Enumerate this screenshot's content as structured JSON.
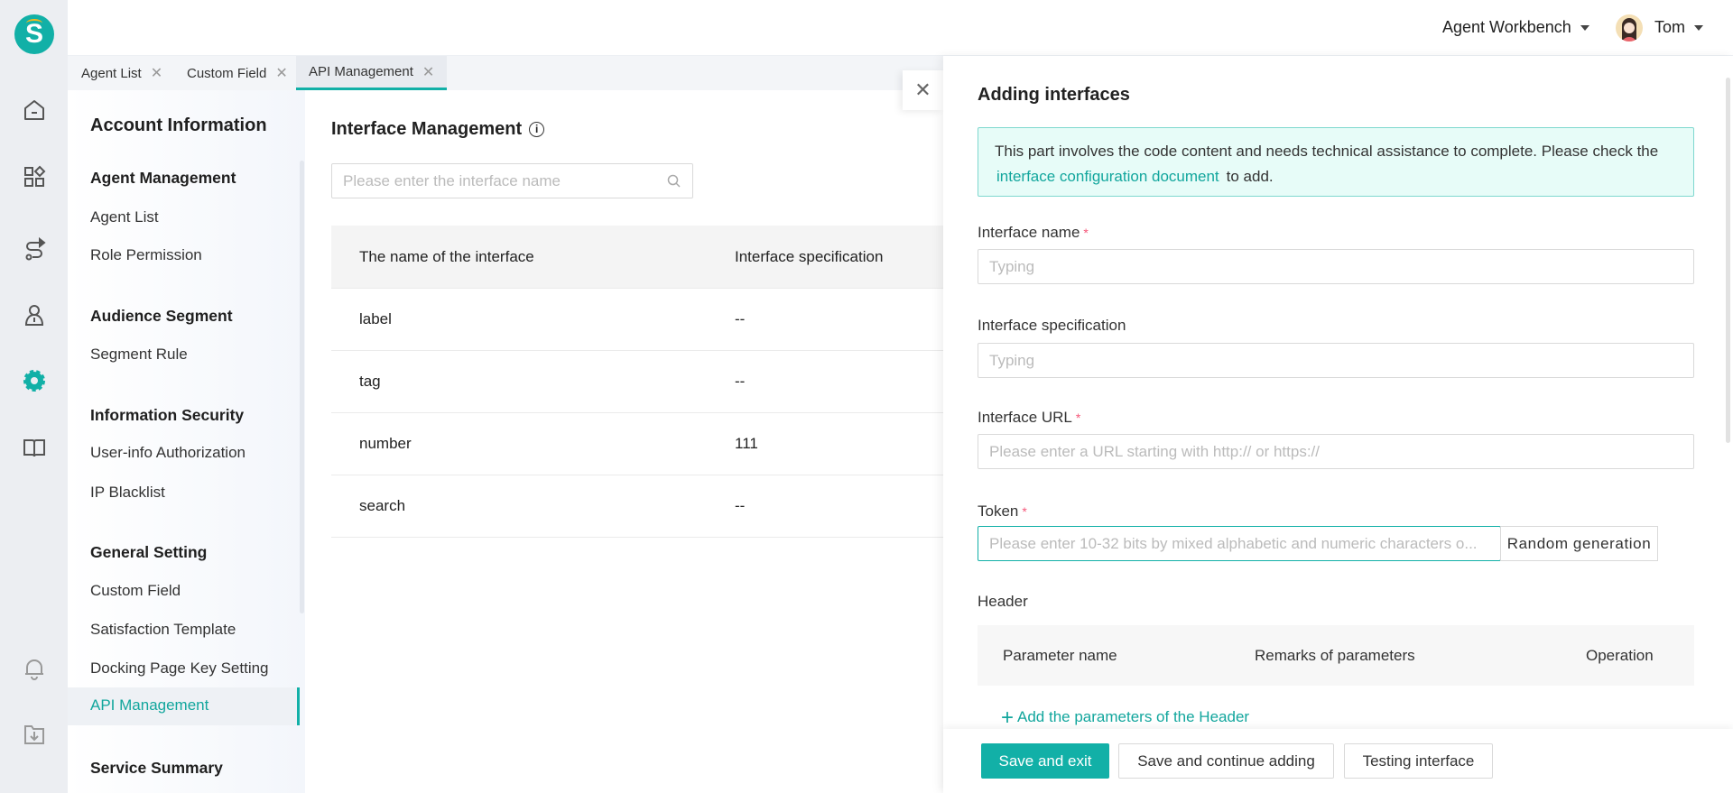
{
  "header": {
    "workspace": "Agent Workbench",
    "user": "Tom"
  },
  "iconbar": {
    "items": [
      "home-icon",
      "apps-icon",
      "routing-icon",
      "agent-icon",
      "settings-icon",
      "book-icon",
      "bell-icon",
      "download-folder-icon"
    ],
    "active": "settings-icon",
    "logo_letter": "S"
  },
  "tabs": [
    {
      "label": "Agent List"
    },
    {
      "label": "Custom Field"
    },
    {
      "label": "API Management",
      "active": true
    }
  ],
  "subnav": {
    "title": "Account Information",
    "sections": [
      {
        "heading": "Agent Management",
        "items": [
          "Agent List",
          "Role Permission"
        ]
      },
      {
        "heading": "Audience Segment",
        "items": [
          "Segment Rule"
        ]
      },
      {
        "heading": "Information Security",
        "items": [
          "User-info Authorization",
          "IP Blacklist"
        ]
      },
      {
        "heading": "General Setting",
        "items": [
          "Custom Field",
          "Satisfaction Template",
          "Docking Page Key Setting",
          "API Management"
        ]
      },
      {
        "heading": "Service Summary",
        "items": []
      }
    ],
    "active": "API Management"
  },
  "main": {
    "title": "Interface Management",
    "search_placeholder": "Please enter the interface name",
    "columns": [
      "The name of the interface",
      "Interface specification"
    ],
    "rows": [
      [
        "label",
        "--"
      ],
      [
        "tag",
        "--"
      ],
      [
        "number",
        "111"
      ],
      [
        "search",
        "--"
      ]
    ]
  },
  "drawer": {
    "title": "Adding interfaces",
    "alert_text": "This part involves the code content and needs technical assistance to complete. Please check the",
    "alert_link": "interface configuration document",
    "alert_suffix": "to add.",
    "fields": {
      "name_label": "Interface name",
      "name_placeholder": "Typing",
      "spec_label": "Interface specification",
      "spec_placeholder": "Typing",
      "url_label": "Interface URL",
      "url_placeholder": "Please enter a URL starting with http:// or https://",
      "token_label": "Token",
      "token_placeholder": "Please enter 10-32 bits by mixed alphabetic and numeric characters o...",
      "random_button": "Random generation",
      "required_mark": "*"
    },
    "header_section": {
      "label": "Header",
      "columns": [
        "Parameter name",
        "Remarks of parameters",
        "Operation"
      ],
      "add_label": "Add the parameters of the Header"
    },
    "footer": {
      "save_exit": "Save and exit",
      "save_continue": "Save and continue adding",
      "test": "Testing interface"
    }
  },
  "colors": {
    "accent": "#12b0a7",
    "required": "#f5587a",
    "alert_bg": "#e7fcf8"
  }
}
